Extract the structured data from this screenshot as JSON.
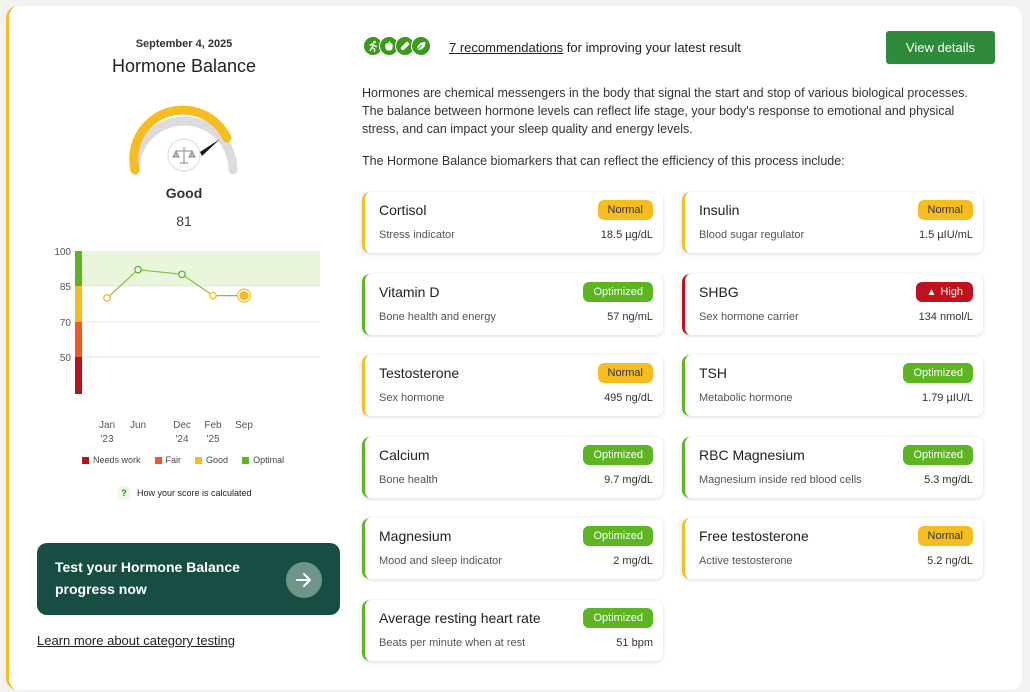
{
  "header": {
    "date": "September 4, 2025",
    "title": "Hormone Balance"
  },
  "gauge": {
    "label": "Good",
    "score": "81",
    "score_value": 81,
    "icon": "scale-icon"
  },
  "trend_chart": {
    "y_ticks": [
      "100",
      "85",
      "70",
      "50"
    ],
    "x_labels": [
      {
        "l1": "Jan",
        "l2": "'23"
      },
      {
        "l1": "Jun",
        "l2": ""
      },
      {
        "l1": "Dec",
        "l2": "'24"
      },
      {
        "l1": "Feb",
        "l2": "'25"
      },
      {
        "l1": "Sep",
        "l2": ""
      }
    ],
    "scores": [
      80,
      92,
      90,
      81,
      81
    ]
  },
  "legend": {
    "items": [
      {
        "label": "Needs work",
        "color": "#b5121b"
      },
      {
        "label": "Fair",
        "color": "#f05a22"
      },
      {
        "label": "Good",
        "color": "#f5bd1f"
      },
      {
        "label": "Optimal",
        "color": "#5cb521"
      }
    ]
  },
  "how_calc": {
    "icon_text": "?",
    "label": "How your score is calculated"
  },
  "cta": {
    "label": "Test your Hormone Balance progress now",
    "icon": "arrow-right-icon"
  },
  "learn_more": "Learn more about category testing",
  "recommendations": {
    "icons": [
      "running-icon",
      "apple-icon",
      "pill-icon",
      "leaf-icon"
    ],
    "link_text": "7 recommendations",
    "rest_text": " for improving your latest result",
    "button": "View details"
  },
  "description": "Hormones are chemical messengers in the body that signal the start and stop of various biological processes. The balance between hormone levels can reflect life stage, your body's response to emotional and physical stress, and can impact your sleep quality and energy levels.",
  "description2": "The Hormone Balance biomarkers that can reflect the efficiency of this process include:",
  "biomarkers": [
    {
      "name": "Cortisol",
      "desc": "Stress indicator",
      "value": "18.5 µg/dL",
      "status": "Normal"
    },
    {
      "name": "Insulin",
      "desc": "Blood sugar regulator",
      "value": "1.5 µIU/mL",
      "status": "Normal"
    },
    {
      "name": "Vitamin D",
      "desc": "Bone health and energy",
      "value": "57 ng/mL",
      "status": "Optimized"
    },
    {
      "name": "SHBG",
      "desc": "Sex hormone carrier",
      "value": "134 nmol/L",
      "status": "High"
    },
    {
      "name": "Testosterone",
      "desc": "Sex hormone",
      "value": "495 ng/dL",
      "status": "Normal"
    },
    {
      "name": "TSH",
      "desc": "Metabolic hormone",
      "value": "1.79 µIU/L",
      "status": "Optimized"
    },
    {
      "name": "Calcium",
      "desc": "Bone health",
      "value": "9.7 mg/dL",
      "status": "Optimized"
    },
    {
      "name": "RBC Magnesium",
      "desc": "Magnesium inside red blood cells",
      "value": "5.3 mg/dL",
      "status": "Optimized"
    },
    {
      "name": "Magnesium",
      "desc": "Mood and sleep indicator",
      "value": "2 mg/dL",
      "status": "Optimized"
    },
    {
      "name": "Free testosterone",
      "desc": "Active testosterone",
      "value": "5.2 ng/dL",
      "status": "Normal"
    },
    {
      "name": "Average resting heart rate",
      "desc": "Beats per minute when at rest",
      "value": "51 bpm",
      "status": "Optimized"
    }
  ],
  "colors": {
    "accent_green": "#2f8a3c",
    "cta_bg": "#184d44",
    "normal": "#f5bd1f",
    "optimized": "#5cb521",
    "high": "#c0111f"
  }
}
